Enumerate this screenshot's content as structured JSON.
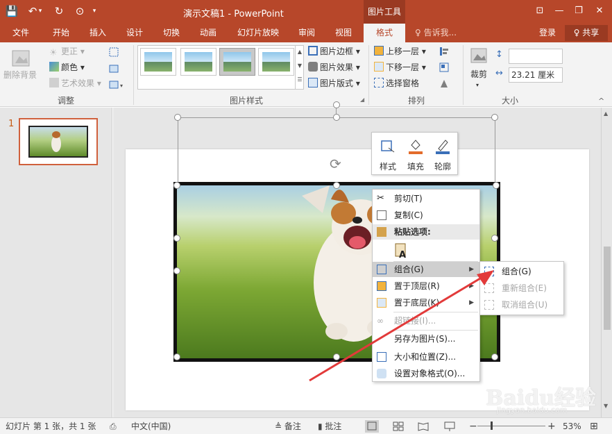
{
  "titlebar": {
    "doc_title": "演示文稿1 - PowerPoint",
    "context_tool": "图片工具",
    "icons": [
      "save-icon",
      "undo-icon",
      "redo-icon",
      "slideshow-start-icon",
      "customize-qat-icon"
    ],
    "window_buttons": [
      "ribbon-display-icon",
      "minimize-icon",
      "restore-icon",
      "close-icon"
    ],
    "glyphs": {
      "save": "💾",
      "undo": "↶",
      "redo": "↻",
      "start": "⊙",
      "more": "▾",
      "ribbon": "⊡",
      "min": "—",
      "restore": "❐",
      "close": "✕"
    }
  },
  "tabs": [
    {
      "label": "文件"
    },
    {
      "label": "开始"
    },
    {
      "label": "插入"
    },
    {
      "label": "设计"
    },
    {
      "label": "切换"
    },
    {
      "label": "动画"
    },
    {
      "label": "幻灯片放映"
    },
    {
      "label": "审阅"
    },
    {
      "label": "视图"
    },
    {
      "label": "格式"
    }
  ],
  "active_tab": "格式",
  "tell_me": "♀ 告诉我...",
  "login": "登录",
  "share": "♀ 共享",
  "ribbon": {
    "adjust": {
      "remove_bg": "删除背景",
      "corrections": "更正 ▾",
      "color": "颜色 ▾",
      "artistic": "艺术效果 ▾",
      "label": "调整"
    },
    "styles": {
      "label": "图片样式",
      "border": "图片边框 ▾",
      "effects": "图片效果 ▾",
      "layout": "图片版式 ▾"
    },
    "arrange": {
      "label": "排列",
      "bring_forward": "上移一层 ▾",
      "send_backward": "下移一层 ▾",
      "selection_pane": "选择窗格"
    },
    "size": {
      "label": "大小",
      "crop": "裁剪",
      "crop_arrow": "▾",
      "height": "",
      "width": "23.21 厘米"
    },
    "collapse": "^"
  },
  "sidebar": {
    "slide_number": "1"
  },
  "mini_toolbar": {
    "style": "样式",
    "fill": "填充",
    "outline": "轮廓"
  },
  "context_menu": {
    "cut": "剪切(T)",
    "copy": "复制(C)",
    "paste_options": "粘贴选项:",
    "group": "组合(G)",
    "bring_to_front": "置于顶层(R)",
    "send_to_back": "置于底层(K)",
    "hyperlink": "超链接(I)...",
    "save_as_picture": "另存为图片(S)...",
    "size_position": "大小和位置(Z)...",
    "format_object": "设置对象格式(O)..."
  },
  "submenu": {
    "group": "组合(G)",
    "regroup": "重新组合(E)",
    "ungroup": "取消组合(U)"
  },
  "statusbar": {
    "slide_info": "幻灯片 第 1 张，共 1 张",
    "language": "中文(中国)",
    "notes": "≜ 备注",
    "comments": "▮ 批注",
    "zoom_minus": "−",
    "zoom_plus": "+",
    "zoom": "53%",
    "fit_icon": "⊞"
  },
  "watermark": {
    "text": "Baidu经验",
    "url": "jingyan.baidu.com"
  }
}
